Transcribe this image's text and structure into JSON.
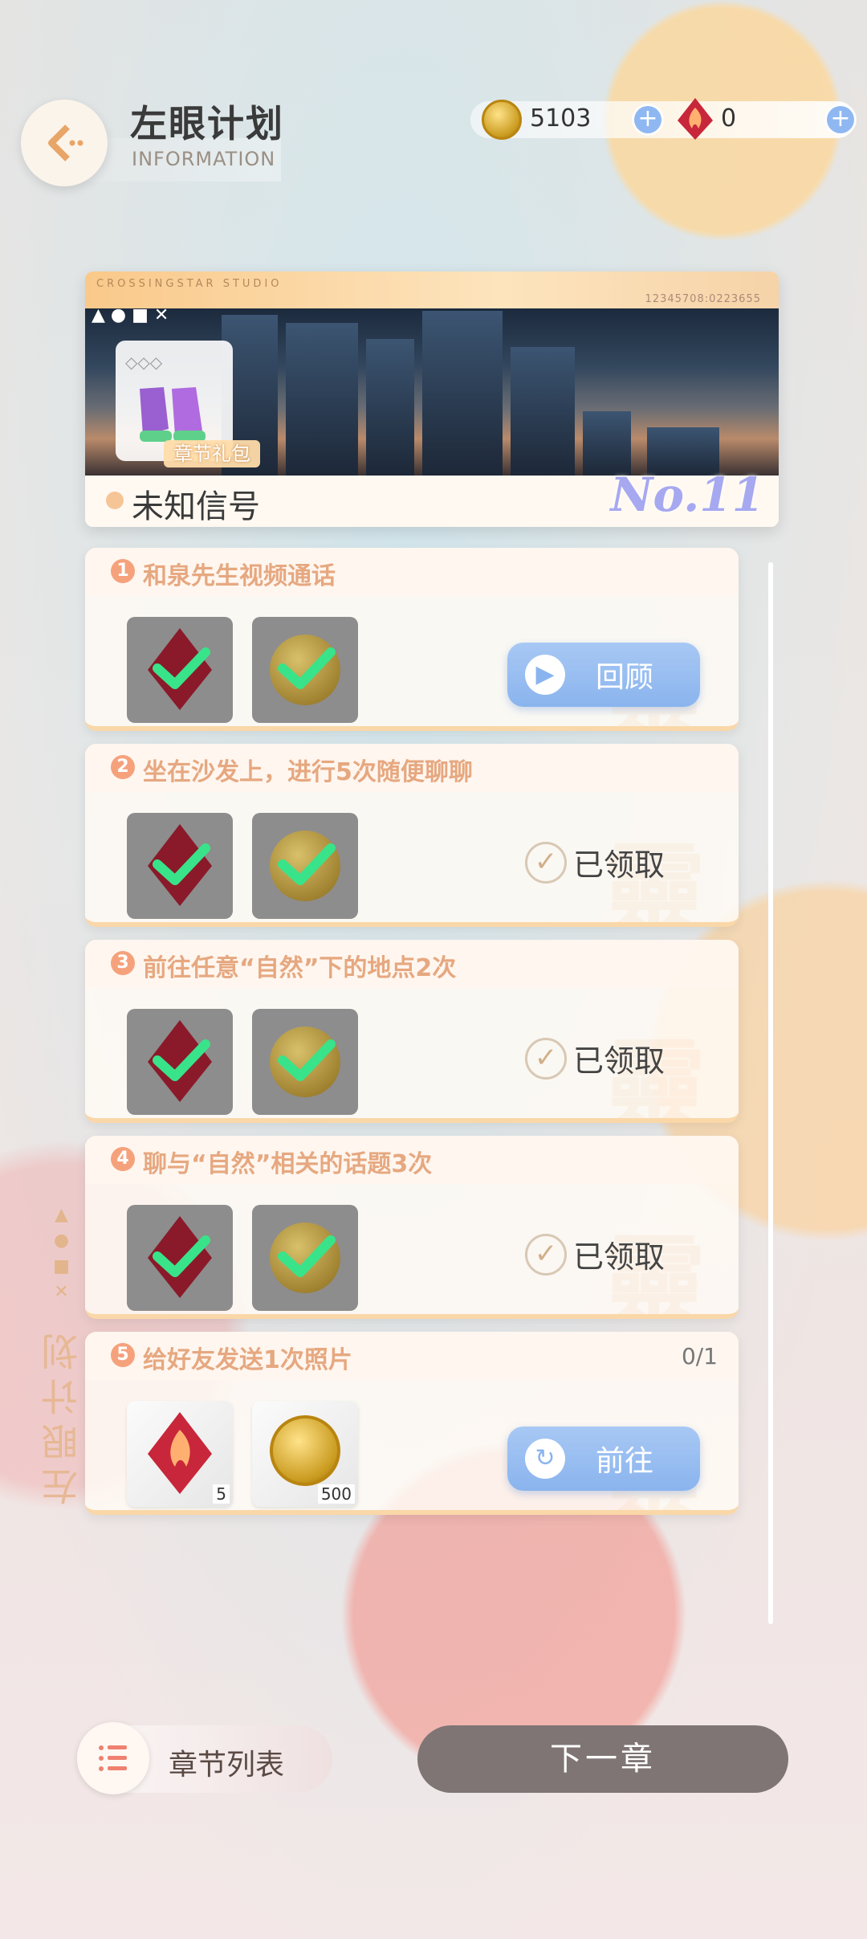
{
  "header": {
    "title": "左眼计划",
    "subtitle": "INFORMATION"
  },
  "currency": {
    "coins": "5103",
    "gems": "0"
  },
  "banner": {
    "studio": "CROSSINGSTAR STUDIO",
    "serial": "12345708:0223655",
    "gift_label": "章节礼包",
    "chapter_name": "未知信号",
    "chapter_no": "No.11"
  },
  "tasks": [
    {
      "num": "1",
      "text": "和泉先生视频通话",
      "progress": "",
      "action": "回顾",
      "status": "review"
    },
    {
      "num": "2",
      "text": "坐在沙发上，进行5次随便聊聊",
      "progress": "",
      "action": "已领取",
      "status": "claimed"
    },
    {
      "num": "3",
      "text": "前往任意“自然”下的地点2次",
      "progress": "",
      "action": "已领取",
      "status": "claimed"
    },
    {
      "num": "4",
      "text": "聊与“自然”相关的话题3次",
      "progress": "",
      "action": "已领取",
      "status": "claimed"
    },
    {
      "num": "5",
      "text": "给好友发送1次照片",
      "progress": "0/1",
      "action": "前往",
      "status": "goto",
      "reward_gem_count": "5",
      "reward_coin_count": "500"
    }
  ],
  "side_text": "左眼计划",
  "footer": {
    "chapter_list": "章节列表",
    "next_chapter": "下一章"
  },
  "colors": {
    "accent_blue": "#8ab4ee",
    "task_number": "#f5a27c",
    "next_button": "#7f7575"
  }
}
